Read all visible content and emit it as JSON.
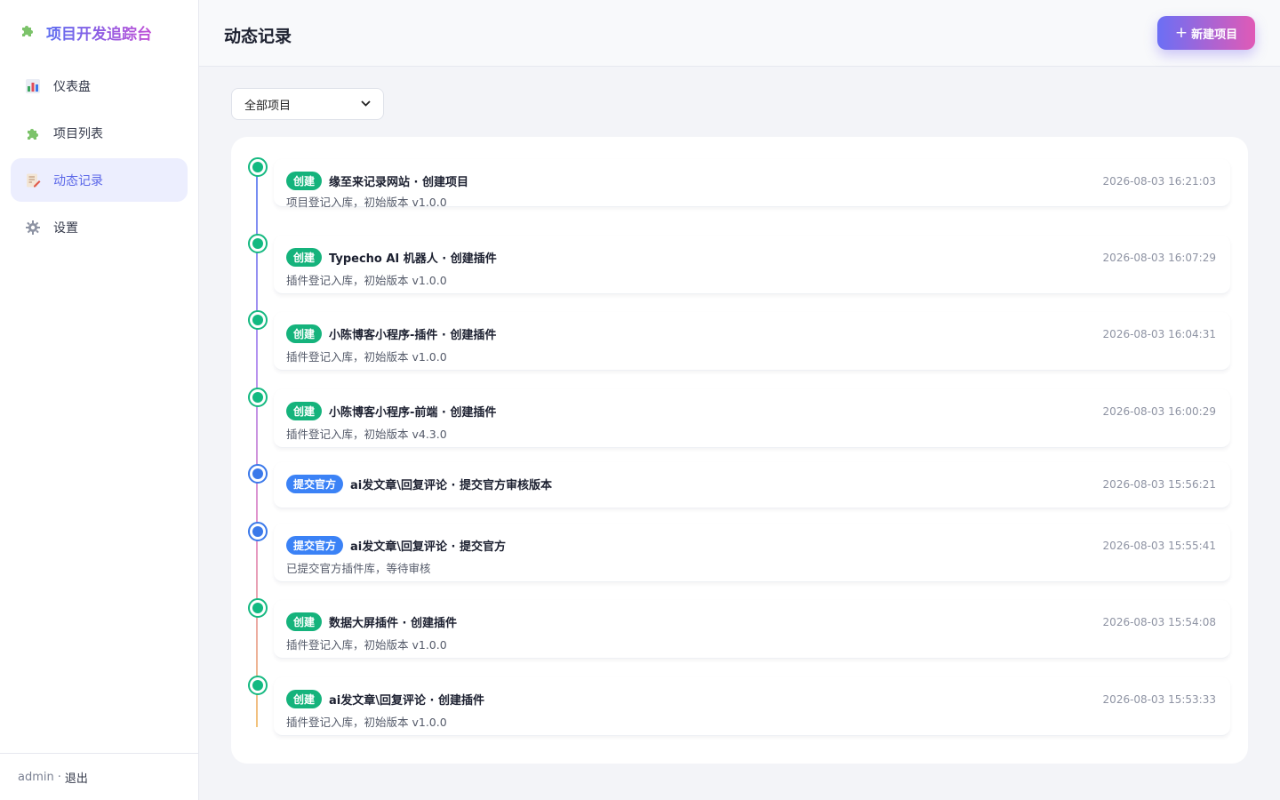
{
  "app": {
    "title": "项目开发追踪台",
    "accent_start": "#5b6cf0",
    "accent_end": "#c04fd6"
  },
  "sidebar": {
    "items": [
      {
        "label": "仪表盘",
        "icon": "bar-chart-icon",
        "active": false
      },
      {
        "label": "项目列表",
        "icon": "puzzle-icon",
        "active": false
      },
      {
        "label": "动态记录",
        "icon": "memo-icon",
        "active": true
      },
      {
        "label": "设置",
        "icon": "gear-icon",
        "active": false
      }
    ],
    "footer": {
      "user": "admin",
      "separator": "·",
      "logout": "退出"
    }
  },
  "header": {
    "title": "动态记录",
    "new_button": "新建项目",
    "new_button_icon": "plus-icon"
  },
  "filter": {
    "selected": "全部项目"
  },
  "timeline": [
    {
      "badge": "创建",
      "type": "create",
      "title": "缘至来记录网站 · 创建项目",
      "desc": "项目登记入库，初始版本 v1.0.0",
      "time": "2026-08-03 16:21:03"
    },
    {
      "badge": "创建",
      "type": "create",
      "title": "Typecho AI 机器人 · 创建插件",
      "desc": "插件登记入库，初始版本 v1.0.0",
      "time": "2026-08-03 16:07:29"
    },
    {
      "badge": "创建",
      "type": "create",
      "title": "小陈博客小程序-插件 · 创建插件",
      "desc": "插件登记入库，初始版本 v1.0.0",
      "time": "2026-08-03 16:04:31"
    },
    {
      "badge": "创建",
      "type": "create",
      "title": "小陈博客小程序-前端 · 创建插件",
      "desc": "插件登记入库，初始版本 v4.3.0",
      "time": "2026-08-03 16:00:29"
    },
    {
      "badge": "提交官方",
      "type": "submit",
      "title": "ai发文章\\回复评论 · 提交官方审核版本",
      "desc": "",
      "time": "2026-08-03 15:56:21"
    },
    {
      "badge": "提交官方",
      "type": "submit",
      "title": "ai发文章\\回复评论 · 提交官方",
      "desc": "已提交官方插件库，等待审核",
      "time": "2026-08-03 15:55:41"
    },
    {
      "badge": "创建",
      "type": "create",
      "title": "数据大屏插件 · 创建插件",
      "desc": "插件登记入库，初始版本 v1.0.0",
      "time": "2026-08-03 15:54:08"
    },
    {
      "badge": "创建",
      "type": "create",
      "title": "ai发文章\\回复评论 · 创建插件",
      "desc": "插件登记入库，初始版本 v1.0.0",
      "time": "2026-08-03 15:53:33"
    }
  ]
}
